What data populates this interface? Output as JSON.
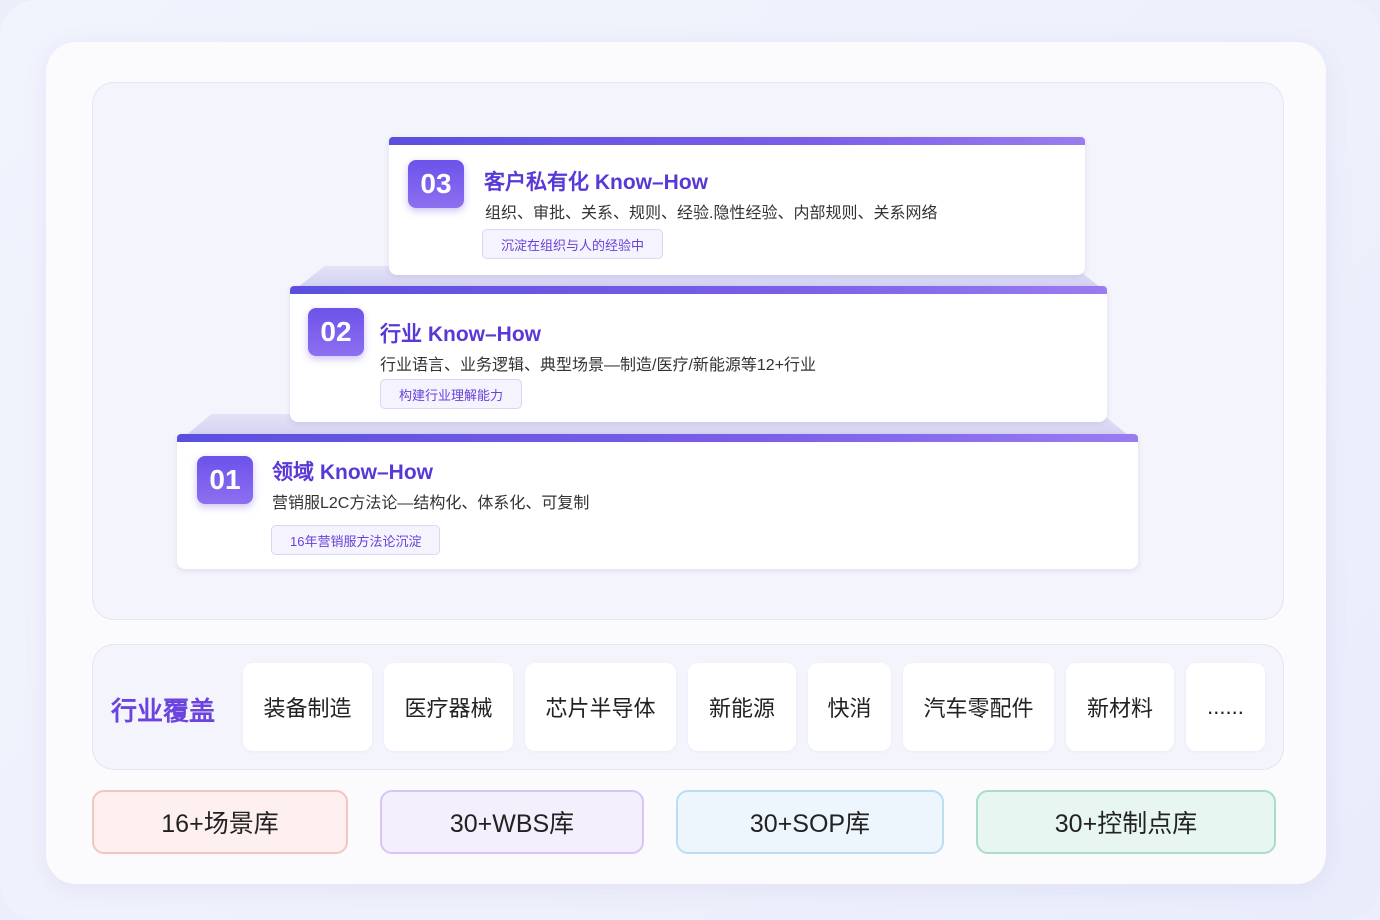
{
  "tiers": [
    {
      "num": "03",
      "title": "客户私有化 Know–How",
      "desc": "组织、审批、关系、规则、经验.隐性经验、内部规则、关系网络",
      "tag": "沉淀在组织与人的经验中"
    },
    {
      "num": "02",
      "title": "行业 Know–How",
      "desc": "行业语言、业务逻辑、典型场景—制造/医疗/新能源等12+行业",
      "tag": "构建行业理解能力"
    },
    {
      "num": "01",
      "title": "领域 Know–How",
      "desc": "营销服L2C方法论—结构化、体系化、可复制",
      "tag": "16年营销服方法论沉淀"
    }
  ],
  "industry": {
    "label": "行业覆盖",
    "items": [
      "装备制造",
      "医疗器械",
      "芯片半导体",
      "新能源",
      "快消",
      "汽车零配件",
      "新材料",
      "......"
    ]
  },
  "libraries": [
    {
      "label": "16+场景库",
      "bg": "#fdf0ef",
      "border": "#f4c4c0"
    },
    {
      "label": "30+WBS库",
      "bg": "#f4effd",
      "border": "#d7c6f4"
    },
    {
      "label": "30+SOP库",
      "bg": "#eef6fd",
      "border": "#bcdcf2"
    },
    {
      "label": "30+控制点库",
      "bg": "#e8f6f1",
      "border": "#a9dcc9"
    }
  ],
  "colors": {
    "accent": "#5a38d6",
    "badge": "#6d52ea"
  }
}
